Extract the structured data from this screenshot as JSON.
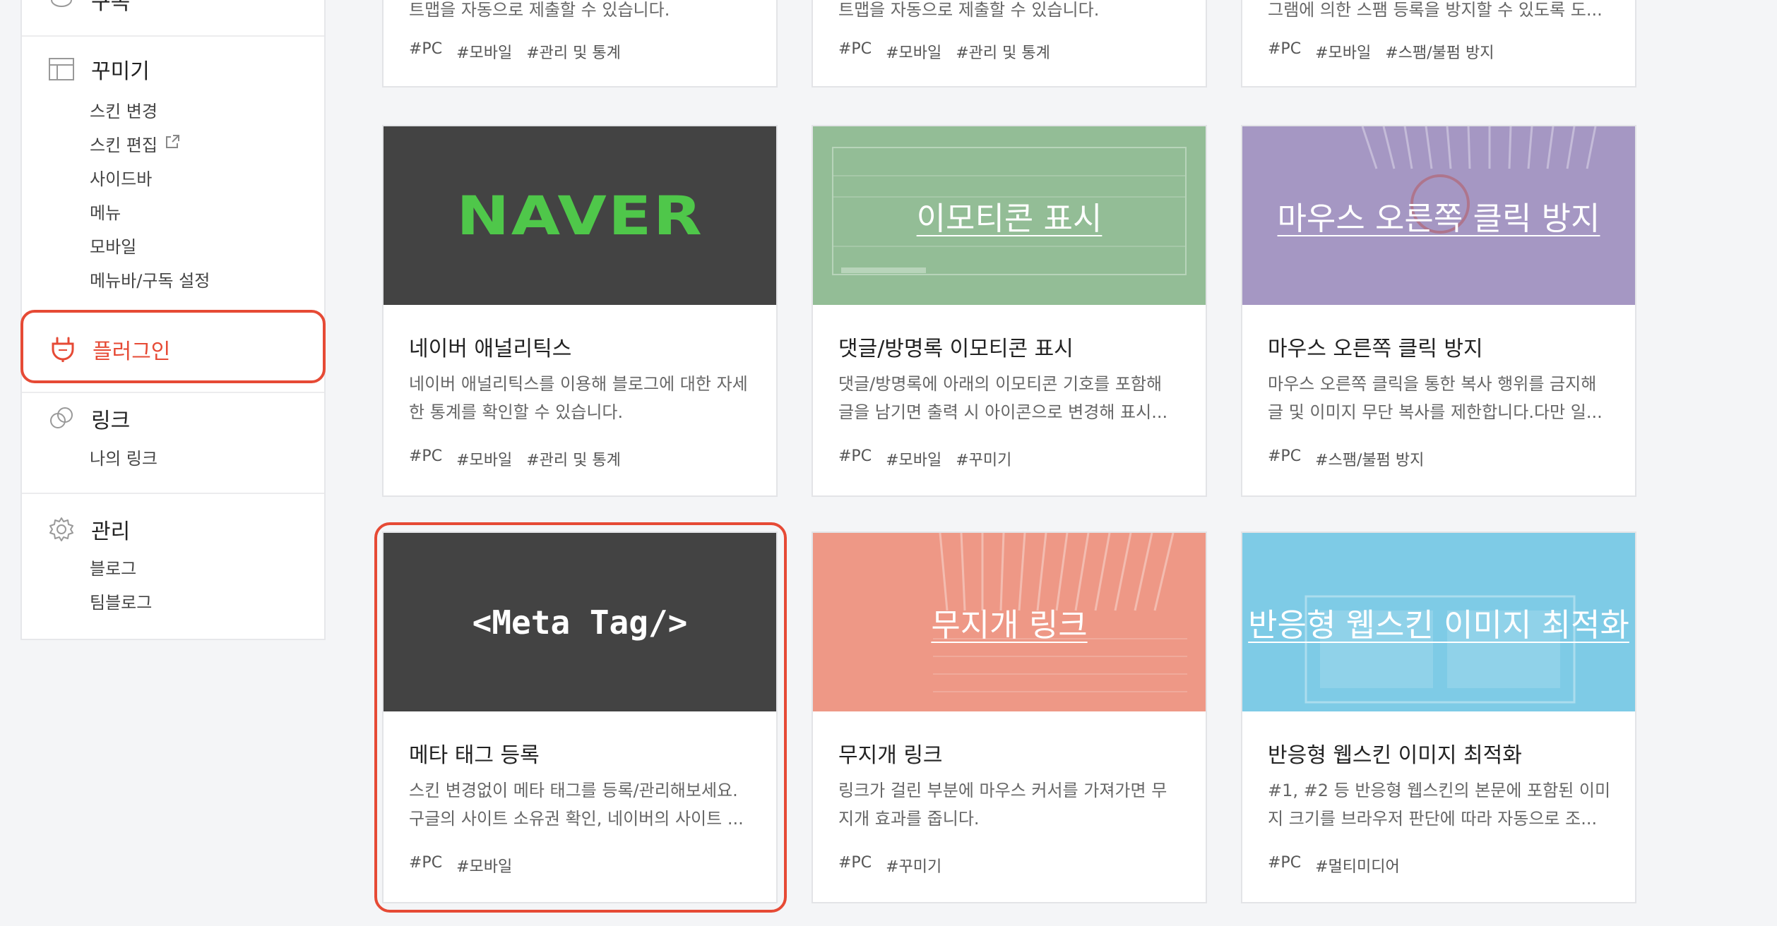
{
  "sidebar": {
    "group0_sub": "구독",
    "decorate": {
      "title": "꾸미기",
      "items": [
        "스킨 변경",
        "스킨 편집",
        "사이드바",
        "메뉴",
        "모바일",
        "메뉴바/구독 설정"
      ]
    },
    "plugin": {
      "title": "플러그인"
    },
    "link": {
      "title": "링크",
      "items": [
        "나의 링크"
      ]
    },
    "manage": {
      "title": "관리",
      "items": [
        "블로그",
        "팀블로그"
      ]
    }
  },
  "colors": {
    "accent": "#e64a35",
    "naver_bg": "#434343",
    "emoticon_bg": "#93bd96",
    "mouse_bg": "#a597c3",
    "rainbow_bg": "#ee9886",
    "responsive_bg": "#7ecbe6"
  },
  "cards_top": [
    {
      "desc": "트맵을 자동으로 제출할 수 있습니다.",
      "tags": [
        "#PC",
        "#모바일",
        "#관리 및 통계"
      ]
    },
    {
      "desc": "트맵을 자동으로 제출할 수 있습니다.",
      "tags": [
        "#PC",
        "#모바일",
        "#관리 및 통계"
      ]
    },
    {
      "desc": "그램에 의한 스팸 등록을 방지할 수 있도록 도...",
      "tags": [
        "#PC",
        "#모바일",
        "#스팸/불펌 방지"
      ]
    }
  ],
  "cards": [
    {
      "thumb_text": "NAVER",
      "title": "네이버 애널리틱스",
      "desc": [
        "네이버 애널리틱스를 이용해 블로그에 대한 자세",
        "한 통계를 확인할 수 있습니다."
      ],
      "tags": [
        "#PC",
        "#모바일",
        "#관리 및 통계"
      ]
    },
    {
      "thumb_text": "이모티콘 표시",
      "title": "댓글/방명록 이모티콘 표시",
      "desc": [
        "댓글/방명록에 아래의 이모티콘 기호를 포함해",
        "글을 남기면 출력 시 아이콘으로 변경해 표시..."
      ],
      "tags": [
        "#PC",
        "#모바일",
        "#꾸미기"
      ]
    },
    {
      "thumb_text": "마우스 오른쪽 클릭 방지",
      "title": "마우스 오른쪽 클릭 방지",
      "desc": [
        "마우스 오른쪽 클릭을 통한 복사 행위를 금지해",
        "글 및 이미지 무단 복사를 제한합니다.다만 일..."
      ],
      "tags": [
        "#PC",
        "#스팸/불펌 방지"
      ]
    },
    {
      "thumb_text": "<Meta Tag/>",
      "title": "메타 태그 등록",
      "desc": [
        "스킨 변경없이 메타 태그를 등록/관리해보세요.",
        "구글의 사이트 소유권 확인, 네이버의 사이트 ..."
      ],
      "tags": [
        "#PC",
        "#모바일"
      ]
    },
    {
      "thumb_text": "무지개 링크",
      "title": "무지개 링크",
      "desc": [
        "링크가 걸린 부분에 마우스 커서를 가져가면 무",
        "지개 효과를 줍니다."
      ],
      "tags": [
        "#PC",
        "#꾸미기"
      ]
    },
    {
      "thumb_text": "반응형 웹스킨 이미지 최적화",
      "title": "반응형 웹스킨 이미지 최적화",
      "desc": [
        "#1, #2 등 반응형 웹스킨의 본문에 포함된 이미",
        "지 크기를 브라우저 판단에 따라 자동으로 조..."
      ],
      "tags": [
        "#PC",
        "#멀티미디어"
      ]
    }
  ]
}
